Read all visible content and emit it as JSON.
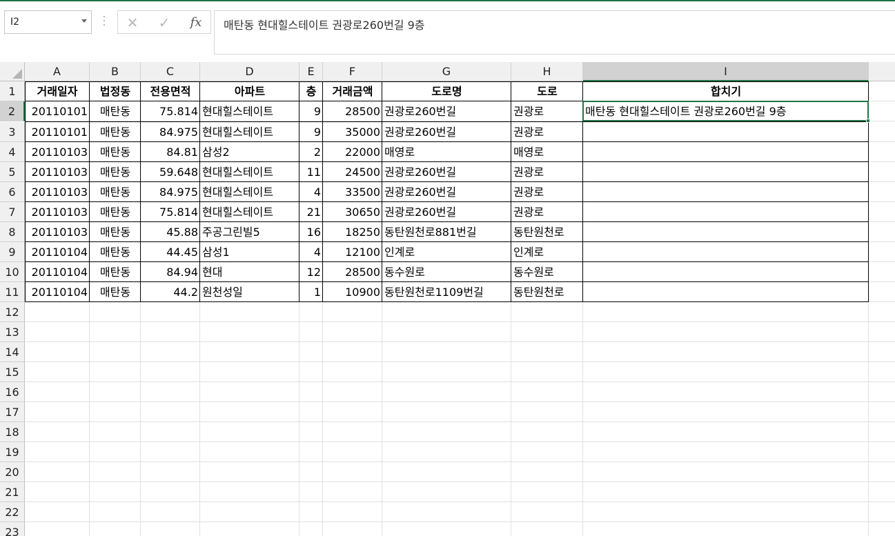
{
  "name_box": {
    "value": "I2"
  },
  "formula_bar": {
    "cancel_glyph": "✕",
    "enter_glyph": "✓",
    "function_glyph": "fx",
    "value": "매탄동 현대힐스테이트 권광로260번길 9층"
  },
  "columns": [
    "A",
    "B",
    "C",
    "D",
    "E",
    "F",
    "G",
    "H",
    "I"
  ],
  "selected_column": "I",
  "rows": [
    "1",
    "2",
    "3",
    "4",
    "5",
    "6",
    "7",
    "8",
    "9",
    "10",
    "11",
    "12",
    "13",
    "14",
    "15",
    "16",
    "17",
    "18",
    "19",
    "20",
    "21",
    "22",
    "23"
  ],
  "selected_row": "2",
  "table": {
    "headers": [
      "거래일자",
      "법정동",
      "전용면적",
      "아파트",
      "층",
      "거래금액",
      "도로명",
      "도로",
      "합치기"
    ],
    "rows": [
      [
        "20110101",
        "매탄동",
        "75.814",
        "현대힐스테이트",
        "9",
        "28500",
        "권광로260번길",
        "권광로",
        "매탄동 현대힐스테이트 권광로260번길 9층"
      ],
      [
        "20110101",
        "매탄동",
        "84.975",
        "현대힐스테이트",
        "9",
        "35000",
        "권광로260번길",
        "권광로",
        ""
      ],
      [
        "20110103",
        "매탄동",
        "84.81",
        "삼성2",
        "2",
        "22000",
        "매영로",
        "매영로",
        ""
      ],
      [
        "20110103",
        "매탄동",
        "59.648",
        "현대힐스테이트",
        "11",
        "24500",
        "권광로260번길",
        "권광로",
        ""
      ],
      [
        "20110103",
        "매탄동",
        "84.975",
        "현대힐스테이트",
        "4",
        "33500",
        "권광로260번길",
        "권광로",
        ""
      ],
      [
        "20110103",
        "매탄동",
        "75.814",
        "현대힐스테이트",
        "21",
        "30650",
        "권광로260번길",
        "권광로",
        ""
      ],
      [
        "20110103",
        "매탄동",
        "45.88",
        "주공그린빌5",
        "16",
        "18250",
        "동탄원천로881번길",
        "동탄원천로",
        ""
      ],
      [
        "20110104",
        "매탄동",
        "44.45",
        "삼성1",
        "4",
        "12100",
        "인계로",
        "인계로",
        ""
      ],
      [
        "20110104",
        "매탄동",
        "84.94",
        "현대",
        "12",
        "28500",
        "동수원로",
        "동수원로",
        ""
      ],
      [
        "20110104",
        "매탄동",
        "44.2",
        "원천성일",
        "1",
        "10900",
        "동탄원천로1109번길",
        "동탄원천로",
        ""
      ]
    ]
  },
  "colors": {
    "accent": "#217346",
    "header_bg": "#f0f0f0",
    "selected_header_bg": "#d2d2d2",
    "gridline": "#e1e1e1"
  }
}
